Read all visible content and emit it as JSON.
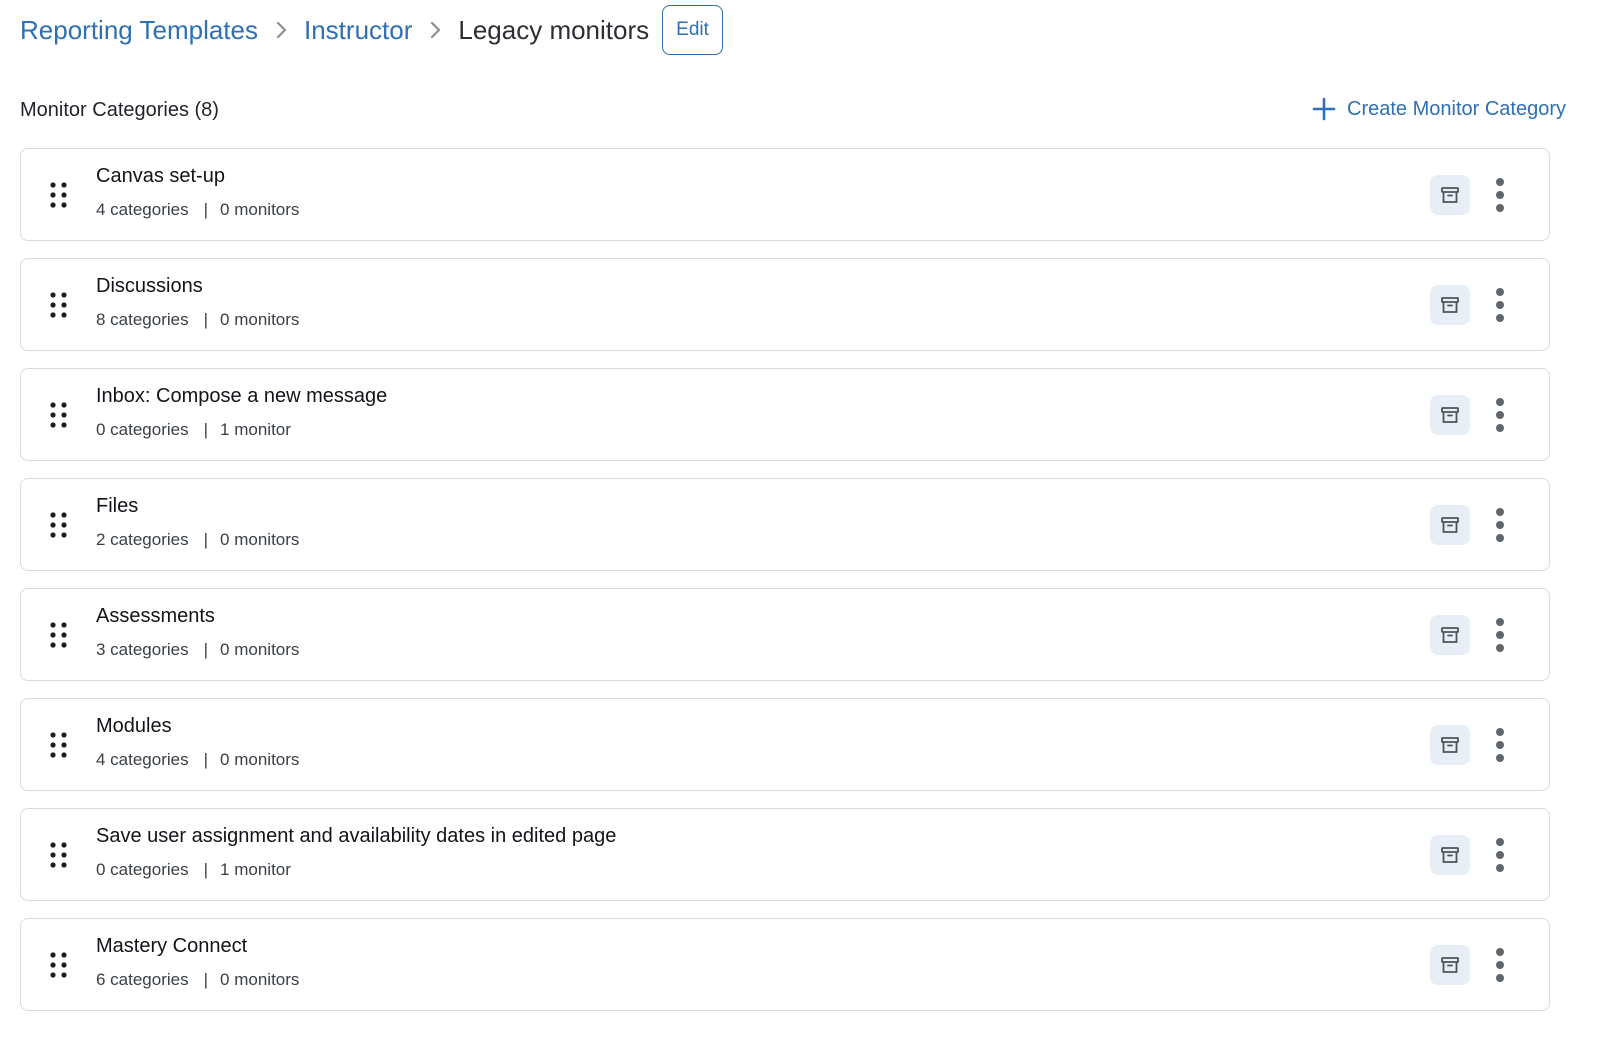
{
  "breadcrumb": {
    "items": [
      {
        "label": "Reporting Templates"
      },
      {
        "label": "Instructor"
      }
    ],
    "current": "Legacy monitors",
    "edit_label": "Edit"
  },
  "section": {
    "title": "Monitor Categories (8)",
    "create_label": "Create Monitor Category"
  },
  "categories": [
    {
      "title": "Canvas set-up",
      "categories_text": "4 categories",
      "monitors_text": "0 monitors"
    },
    {
      "title": "Discussions",
      "categories_text": "8 categories",
      "monitors_text": "0 monitors"
    },
    {
      "title": "Inbox: Compose a new message",
      "categories_text": "0 categories",
      "monitors_text": "1 monitor"
    },
    {
      "title": "Files",
      "categories_text": "2 categories",
      "monitors_text": "0 monitors"
    },
    {
      "title": "Assessments",
      "categories_text": "3 categories",
      "monitors_text": "0 monitors"
    },
    {
      "title": "Modules",
      "categories_text": "4 categories",
      "monitors_text": "0 monitors"
    },
    {
      "title": "Save user assignment and availability dates in edited page",
      "categories_text": "0 categories",
      "monitors_text": "1 monitor"
    },
    {
      "title": "Mastery Connect",
      "categories_text": "6 categories",
      "monitors_text": "0 monitors"
    }
  ],
  "meta_separator": "|",
  "icons": {
    "breadcrumb_separator": "chevron-right-icon",
    "create": "plus-icon",
    "drag": "drag-handle-icon",
    "archive": "archive-icon",
    "more": "more-vertical-icon"
  },
  "colors": {
    "link": "#2f6fb3",
    "card_border": "#d7dbe0",
    "archive_bg": "#e8eef6",
    "text": "#1f2329",
    "icon": "#5f666d"
  }
}
